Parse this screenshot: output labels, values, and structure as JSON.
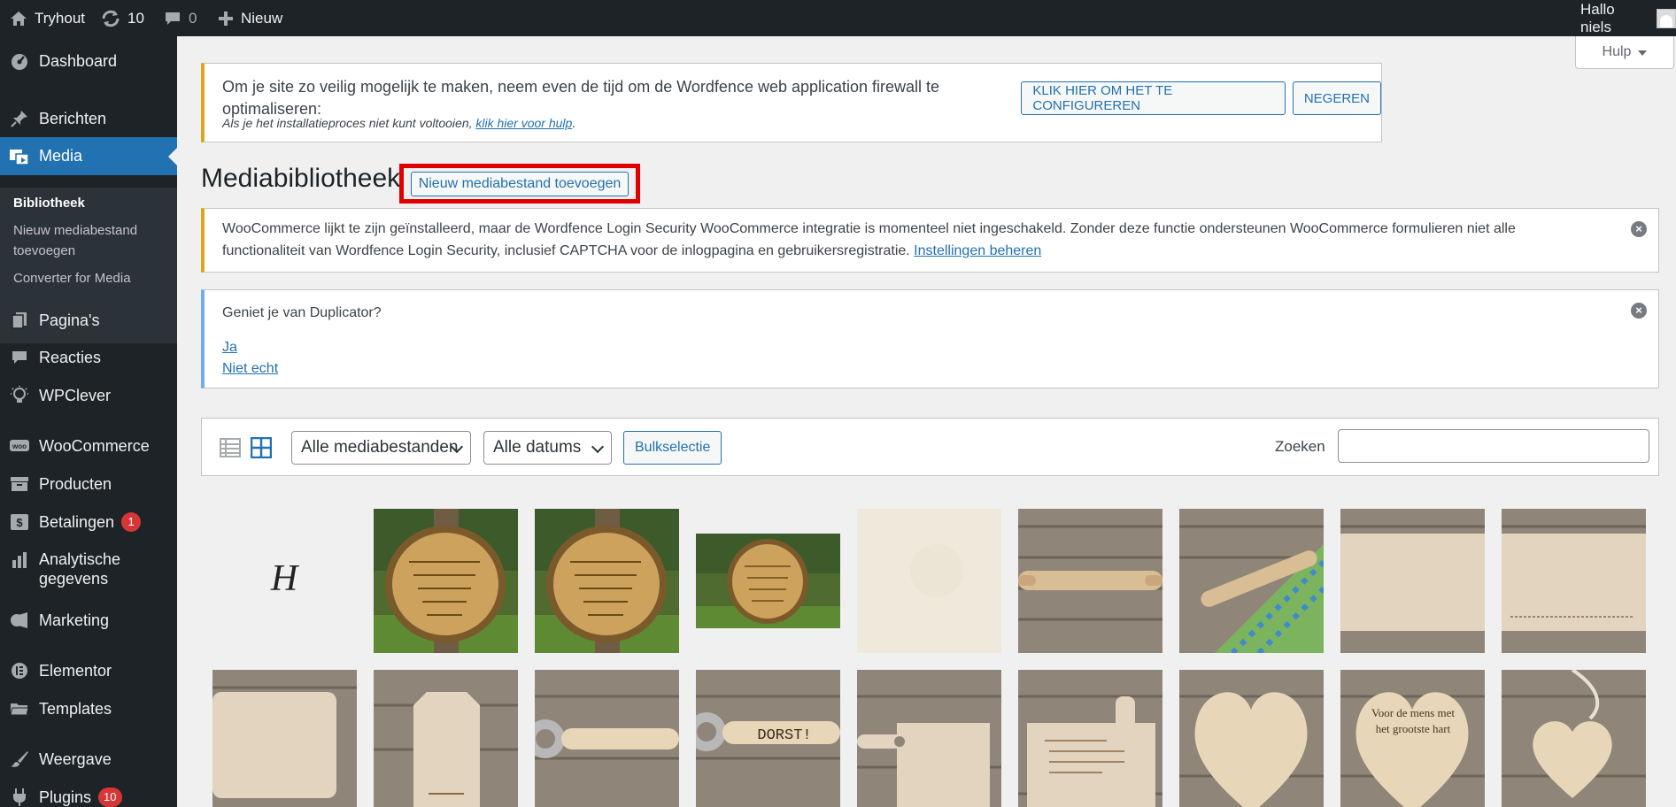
{
  "adminbar": {
    "site_name": "Tryhout",
    "updates_count": "10",
    "comments_count": "0",
    "new_label": "Nieuw",
    "greeting": "Hallo niels"
  },
  "sidebar": {
    "items": [
      {
        "label": "Dashboard",
        "icon": "dashboard-icon"
      },
      {
        "label": "Berichten",
        "icon": "pin-icon"
      },
      {
        "label": "Media",
        "icon": "media-icon",
        "active": true
      },
      {
        "label": "Pagina's",
        "icon": "page-icon"
      },
      {
        "label": "Reacties",
        "icon": "comment-icon"
      },
      {
        "label": "WPClever",
        "icon": "lightbulb-icon"
      },
      {
        "label": "WooCommerce",
        "icon": "woo-icon"
      },
      {
        "label": "Producten",
        "icon": "archive-icon"
      },
      {
        "label": "Betalingen",
        "icon": "money-icon",
        "badge": "1"
      },
      {
        "label": "Analytische gegevens",
        "icon": "chart-bar-icon"
      },
      {
        "label": "Marketing",
        "icon": "megaphone-icon"
      },
      {
        "label": "Elementor",
        "icon": "elementor-icon"
      },
      {
        "label": "Templates",
        "icon": "folder-icon"
      },
      {
        "label": "Weergave",
        "icon": "brush-icon"
      },
      {
        "label": "Plugins",
        "icon": "plugin-icon",
        "badge": "10"
      }
    ],
    "submenu": [
      "Bibliotheek",
      "Nieuw mediabestand toevoegen",
      "Converter for Media"
    ]
  },
  "help_label": "Hulp",
  "wordfence_notice": {
    "text": "Om je site zo veilig mogelijk te maken, neem even de tijd om de Wordfence web application firewall te optimaliseren:",
    "configure_button": "KLIK HIER OM HET TE CONFIGUREREN",
    "dismiss_button": "NEGEREN",
    "help_prefix": "Als je het installatieproces niet kunt voltooien,",
    "help_link": "klik hier voor hulp",
    "help_suffix": "."
  },
  "page": {
    "title": "Mediabibliotheek",
    "add_new": "Nieuw mediabestand toevoegen"
  },
  "woo_notice": {
    "text": "WooCommerce lijkt te zijn geïnstalleerd, maar de Wordfence Login Security WooCommerce integratie is momenteel niet ingeschakeld. Zonder deze functie ondersteunen WooCommerce formulieren niet alle functionaliteit van Wordfence Login Security, inclusief CAPTCHA voor de inlogpagina en gebruikersregistratie.",
    "link": "Instellingen beheren"
  },
  "duplicator_notice": {
    "question": "Geniet je van Duplicator?",
    "yes": "Ja",
    "no": "Niet echt"
  },
  "toolbar": {
    "filter_type": "Alle mediabestanden",
    "filter_date": "Alle datums",
    "bulk": "Bulkselectie",
    "search_label": "Zoeken",
    "search_value": ""
  },
  "thumb_row1": [
    "signature-sketch",
    "wood-disc-park",
    "wood-disc-park",
    "wood-disc-wide",
    "blank-cream",
    "rolling-pin",
    "rolling-pin-cloth",
    "board-plain",
    "board-engraved"
  ],
  "thumb_row2": [
    "board-plain",
    "board-text",
    "bottle-opener",
    "bottle-opener-dorst",
    "paddle-board",
    "paddle-engraved",
    "heart-plain",
    "heart-text",
    "heart-hanger"
  ],
  "thumb_text": {
    "dorst": "DORST!",
    "heart": "Voor de mens met het grootste hart",
    "signature": "H"
  },
  "colors": {
    "accent": "#2271b1",
    "admin_bg": "#1d2327",
    "highlight_frame": "#e00000",
    "badge": "#d63638"
  }
}
